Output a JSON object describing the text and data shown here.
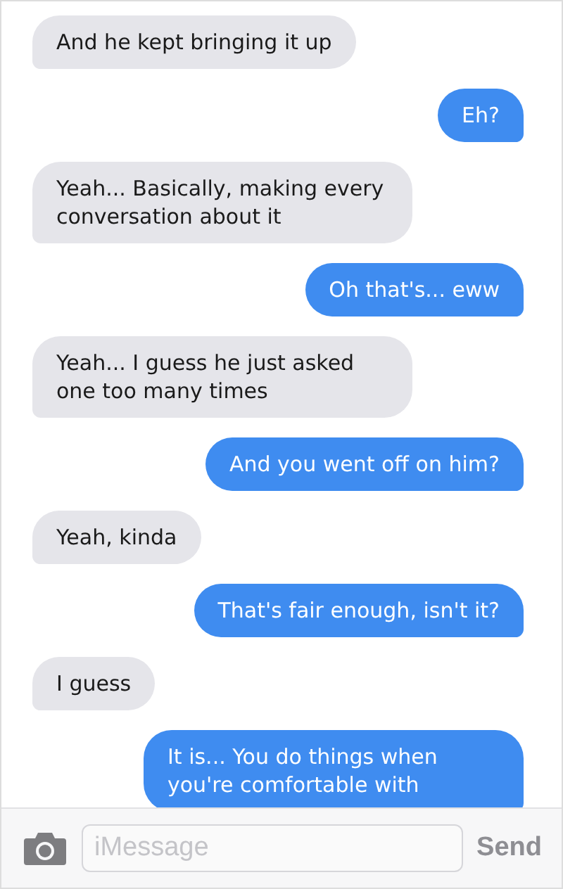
{
  "messages": [
    {
      "kind": "received",
      "text": "And he kept bringing it up"
    },
    {
      "kind": "sent",
      "text": "Eh?"
    },
    {
      "kind": "received",
      "text": "Yeah... Basically, making every conversation about it"
    },
    {
      "kind": "sent",
      "text": "Oh that's... eww"
    },
    {
      "kind": "received",
      "text": "Yeah... I guess he just asked one too many times"
    },
    {
      "kind": "sent",
      "text": "And you went off on him?"
    },
    {
      "kind": "received",
      "text": "Yeah, kinda"
    },
    {
      "kind": "sent",
      "text": "That's fair enough, isn't it?"
    },
    {
      "kind": "received",
      "text": "I guess"
    },
    {
      "kind": "sent",
      "text": "It is... You do things when you're comfortable with"
    }
  ],
  "composer": {
    "placeholder": "iMessage",
    "send": "Send"
  }
}
